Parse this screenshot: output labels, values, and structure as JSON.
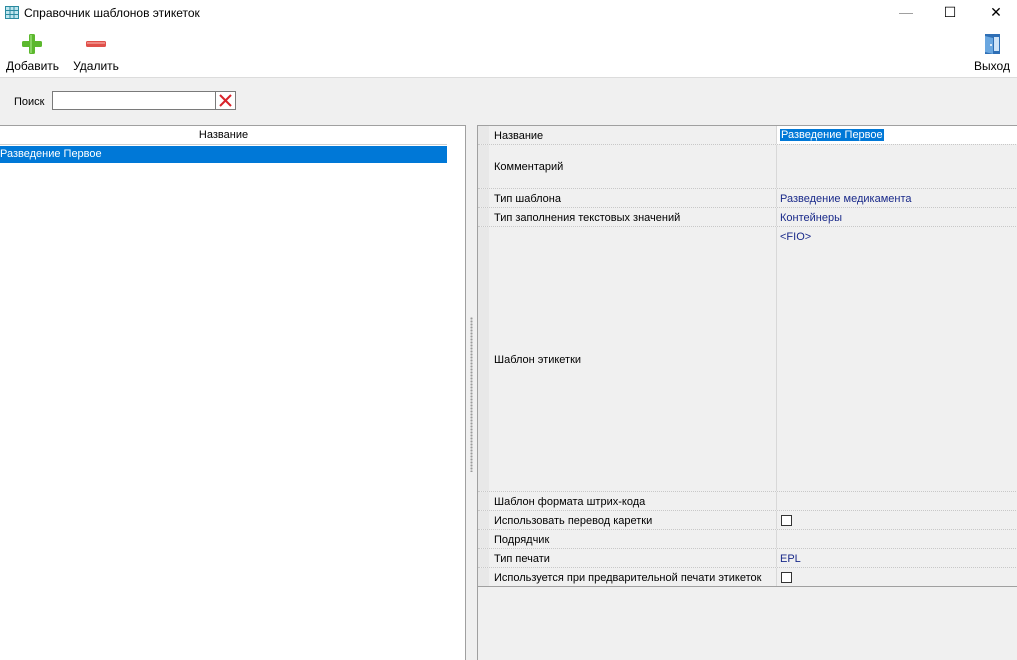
{
  "window": {
    "title": "Справочник шаблонов этикеток",
    "app_icon": "table-grid-icon",
    "minimize_glyph": "—",
    "maximize_glyph": "☐",
    "close_glyph": "✕"
  },
  "toolbar": {
    "add_label": "Добавить",
    "add_icon": "plus-icon",
    "delete_label": "Удалить",
    "delete_icon": "minus-icon",
    "exit_label": "Выход",
    "exit_icon": "exit-door-icon"
  },
  "search": {
    "label": "Поиск",
    "value": "",
    "placeholder": "",
    "clear_icon": "clear-x-icon"
  },
  "list": {
    "column_header": "Название",
    "rows": [
      "Разведение Первое"
    ],
    "selected_index": 0
  },
  "properties": {
    "name": {
      "label": "Название",
      "value": "Разведение Первое"
    },
    "comment": {
      "label": "Комментарий",
      "value": ""
    },
    "template_type": {
      "label": "Тип шаблона",
      "value": "Разведение медикамента"
    },
    "fill_type": {
      "label": "Тип заполнения текстовых значений",
      "value": "Контейнеры"
    },
    "label_template": {
      "label": "Шаблон этикетки",
      "value": "<FIO>"
    },
    "barcode_template": {
      "label": "Шаблон формата штрих-кода",
      "value": ""
    },
    "carriage_return": {
      "label": "Использовать перевод каретки",
      "checked": false
    },
    "contractor": {
      "label": "Подрядчик",
      "value": ""
    },
    "print_type": {
      "label": "Тип печати",
      "value": "EPL"
    },
    "preprint": {
      "label": "Используется при предварительной печати этикеток",
      "checked": false
    }
  },
  "colors": {
    "selection": "#0078d7",
    "value_text": "#1a2a8a",
    "add_icon": "#5cb82e",
    "delete_icon": "#e0504a",
    "clear_icon": "#d9232a"
  }
}
